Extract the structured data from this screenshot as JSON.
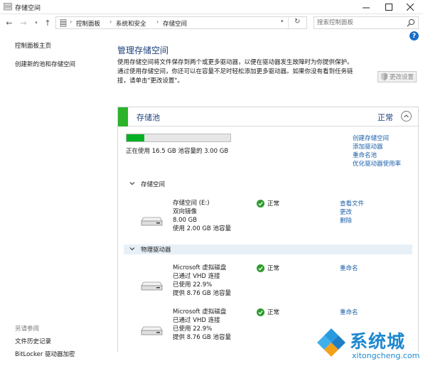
{
  "window": {
    "title": "存储空间"
  },
  "address": {
    "crumbs": [
      "控制面板",
      "系统和安全",
      "存储空间"
    ],
    "search_placeholder": "搜索控制面板"
  },
  "sidebar": {
    "items": [
      {
        "label": "控制面板主页"
      },
      {
        "label": "创建新的池和存储空间"
      }
    ],
    "see_also_heading": "另请参阅",
    "see_also": [
      {
        "label": "文件历史记录"
      },
      {
        "label": "BitLocker 驱动器加密"
      }
    ]
  },
  "main": {
    "title": "管理存储空间",
    "description_lines": [
      "使用存储空间将文件保存到两个或更多驱动器，以便在驱动器发生故障时为你提供保护。",
      "通过使用存储空间，你还可以在容量不足时轻松添加更多驱动器。如果你没有看到任务链",
      "接，请单击\"更改设置\"。"
    ],
    "change_settings_label": "更改设置"
  },
  "pool": {
    "title": "存储池",
    "status": "正常",
    "usage_fraction": 0.17,
    "usage_text": "正在使用 16.5 GB 池容量的 3.00 GB",
    "links": [
      "创建存储空间",
      "添加驱动器",
      "重命名池",
      "优化驱动器使用率"
    ],
    "spaces_heading": "存储空间",
    "spaces": [
      {
        "lines": [
          "存储空间 (E:)",
          "双向镜像",
          "8.00 GB",
          "使用 2.00 GB 池容量"
        ],
        "status": "正常",
        "actions": [
          "查看文件",
          "更改",
          "删除"
        ]
      }
    ],
    "physical_heading": "物理驱动器",
    "physical": [
      {
        "lines": [
          "Microsoft 虚拟磁盘",
          "已通过 VHD 连接",
          "已使用 22.9%",
          "提供 8.76 GB 池容量"
        ],
        "status": "正常",
        "action": "重命名"
      },
      {
        "lines": [
          "Microsoft 虚拟磁盘",
          "已通过 VHD 连接",
          "已使用 22.9%",
          "提供 8.76 GB 池容量"
        ],
        "status": "正常",
        "action": "重命名"
      }
    ]
  },
  "watermark": {
    "name": "系统城",
    "site": "xitongcheng.com"
  },
  "colors": {
    "accent_green": "#2bb32b",
    "link_blue": "#1a5fa8",
    "title_blue": "#1b3f7a"
  }
}
